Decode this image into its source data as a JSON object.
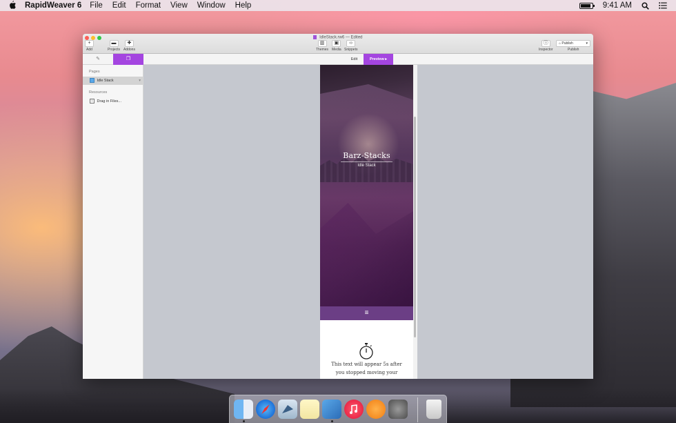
{
  "menubar": {
    "app_name": "RapidWeaver 6",
    "menus": [
      "File",
      "Edit",
      "Format",
      "View",
      "Window",
      "Help"
    ],
    "time": "9:41 AM"
  },
  "window": {
    "document_title": "IdleStack.rw6",
    "edited_status": "— Edited",
    "toolbar": {
      "add": "Add",
      "projects": "Projects",
      "addons": "Addons",
      "themes": "Themes",
      "media": "Media",
      "snippets": "Snippets",
      "inspector": "Inspector",
      "publish_button": "Publish",
      "publish_caption": "Publish"
    },
    "mode_tabs": {
      "edit": "Edit",
      "preview": "Preview"
    }
  },
  "sidebar": {
    "pages_header": "Pages",
    "page_item": "Idle Stack",
    "resources_header": "Resources",
    "drag_files": "Drag in Files..."
  },
  "preview": {
    "site_title": "Barz-Stacks",
    "site_subtitle": "Idle Stack",
    "nav_glyph": "≡",
    "body_text_line1": "This text will appear 5s after",
    "body_text_line2": "you stopped moving your"
  },
  "dock": {
    "icons": [
      "finder-icon",
      "safari-icon",
      "mail-icon",
      "notes-icon",
      "rapidweaver-icon",
      "itunes-icon",
      "ibooks-icon",
      "system-preferences-icon",
      "trash-icon"
    ]
  },
  "colors": {
    "accent": "#a445e0",
    "nav_bar": "#6b3e85"
  }
}
